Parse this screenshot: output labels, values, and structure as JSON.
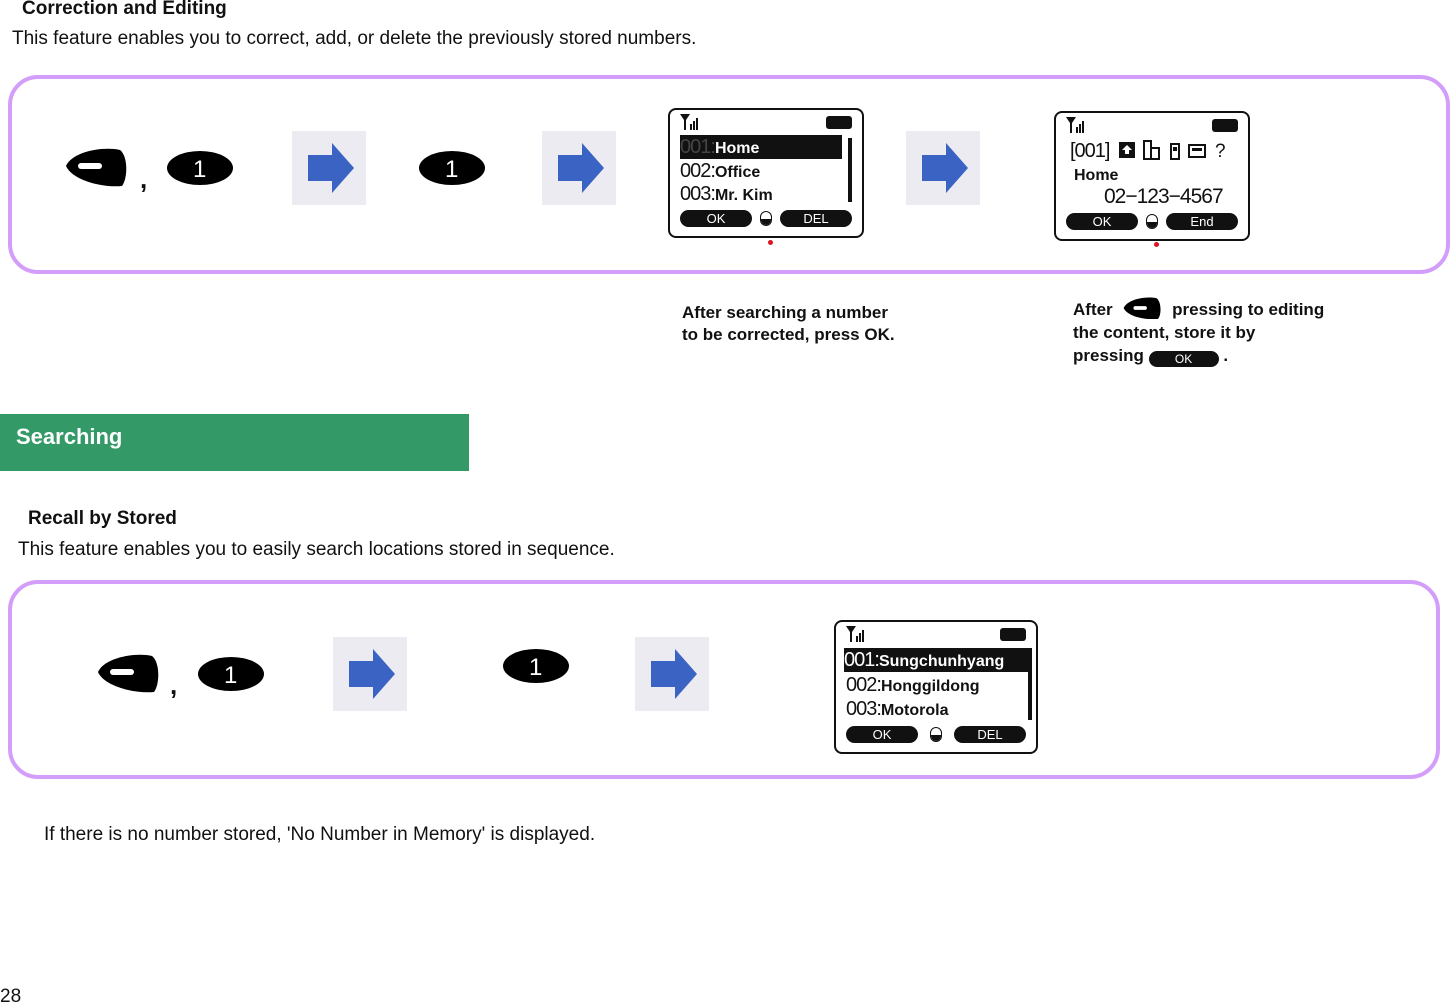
{
  "section1": {
    "heading": "Correction and Editing",
    "description": "This feature enables you to correct, add, or delete the previously stored numbers.",
    "sequence": {
      "first_keys": [
        "menu-key",
        "1"
      ],
      "separator": ",",
      "second_key": "1"
    },
    "screen1": {
      "rows": [
        {
          "num": "001:",
          "name": "Home",
          "selected": true
        },
        {
          "num": "002:",
          "name": "Office",
          "selected": false
        },
        {
          "num": "003:",
          "name": "Mr. Kim",
          "selected": false
        }
      ],
      "softkey_left": "OK",
      "softkey_right": "DEL"
    },
    "screen2": {
      "index": "[001]",
      "type_icons": [
        "home-icon",
        "office-icon",
        "mobile-icon",
        "pager-icon",
        "question-icon"
      ],
      "question_glyph": "?",
      "name": "Home",
      "number": "02−123−4567",
      "softkey_left": "OK",
      "softkey_right": "End"
    },
    "note1_line1": "After searching a number",
    "note1_line2": "to be corrected, press OK.",
    "note2_part1": "After",
    "note2_part2": "pressing to editing",
    "note2_line2": "the content, store it by",
    "note2_line3": "pressing",
    "note2_ok": "OK",
    "note2_end": "."
  },
  "section_bar": {
    "title": "Searching",
    "color": "#339966"
  },
  "section2": {
    "heading": "Recall by Stored",
    "description": "This feature enables you to easily search locations stored in sequence.",
    "sequence": {
      "first_keys": [
        "menu-key",
        "1"
      ],
      "separator": ",",
      "second_key": "1"
    },
    "screen": {
      "rows": [
        {
          "num": "001:",
          "name": "Sungchunhyang",
          "selected": true
        },
        {
          "num": "002:",
          "name": "Honggildong",
          "selected": false
        },
        {
          "num": "003:",
          "name": "Motorola",
          "selected": false
        }
      ],
      "softkey_left": "OK",
      "softkey_right": "DEL"
    }
  },
  "footnote": "If there is no number stored, 'No Number in Memory' is displayed.",
  "page_number": "28",
  "colors": {
    "panel_border": "#d39ef9",
    "arrow": "#3b63c4",
    "arrow_bg": "#ecebf1",
    "indicator_dot": "#e0141e"
  }
}
